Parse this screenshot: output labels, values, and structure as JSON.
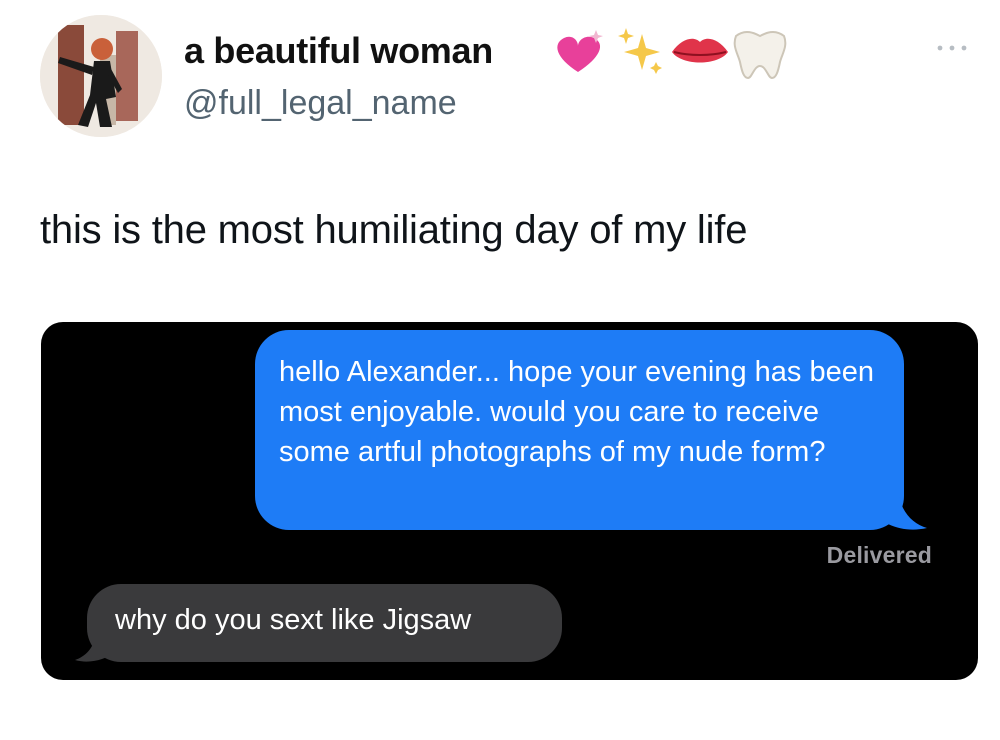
{
  "author": {
    "display_name": "a beautiful woman",
    "name_emojis": [
      "heart-with-sparkles-icon",
      "sparkles-icon",
      "lips-icon",
      "tooth-icon"
    ],
    "handle": "@full_legal_name"
  },
  "post": {
    "text": "this is the most humiliating day of my life"
  },
  "embedded_conversation": {
    "sent_message": "hello Alexander... hope your evening has been most enjoyable. would you care to receive some artful photographs of my nude form?",
    "status": "Delivered",
    "received_message": "why do you sext like Jigsaw"
  },
  "colors": {
    "sent_bubble": "#1e7cf6",
    "received_bubble": "#3a3a3c",
    "screenshot_background": "#000000",
    "handle_gray": "#536471"
  }
}
